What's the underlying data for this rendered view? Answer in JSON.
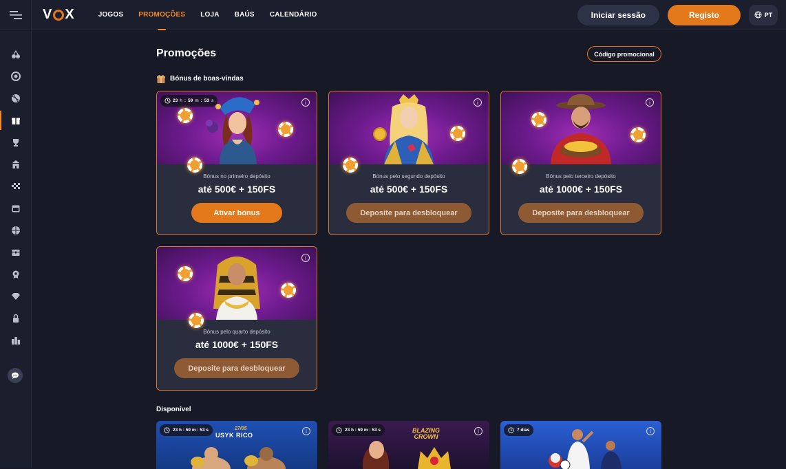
{
  "nav": {
    "logo": "VOX",
    "items": [
      {
        "label": "JOGOS",
        "active": false
      },
      {
        "label": "PROMOÇÕES",
        "active": true
      },
      {
        "label": "LOJA",
        "active": false
      },
      {
        "label": "BAÚS",
        "active": false
      },
      {
        "label": "CALENDÁRIO",
        "active": false
      }
    ],
    "login_label": "Iniciar sessão",
    "register_label": "Registo",
    "lang_label": "PT"
  },
  "sidebar": {
    "icons": [
      "cherries-icon",
      "casino-chip-icon",
      "sports-ball-icon",
      "gift-icon",
      "trophy-icon",
      "shop-icon",
      "racing-flag-icon",
      "calendar-icon",
      "basketball-icon",
      "chest-icon",
      "badge-icon",
      "diamond-icon",
      "lock-icon",
      "leaderboard-icon"
    ],
    "active_index": 3,
    "chat_icon": "chat-icon"
  },
  "page": {
    "title": "Promoções",
    "promo_code_label": "Código promocional",
    "welcome_section": "Bónus de boas-vindas",
    "available_section": "Disponível"
  },
  "welcome_cards": [
    {
      "timer": {
        "h": "23",
        "h_unit": "h",
        "m": "59",
        "m_unit": "m",
        "s": "53",
        "s_unit": "s"
      },
      "subtitle": "Bónus no primeiro depósito",
      "amount": "até 500€ + 150FS",
      "cta": "Ativar bónus",
      "locked": false
    },
    {
      "timer": null,
      "subtitle": "Bónus pelo segundo depósito",
      "amount": "até 500€ + 150FS",
      "cta": "Deposite para desbloquear",
      "locked": true
    },
    {
      "timer": null,
      "subtitle": "Bónus pelo terceiro depósito",
      "amount": "até 1000€ + 150FS",
      "cta": "Deposite para desbloquear",
      "locked": true
    },
    {
      "timer": null,
      "subtitle": "Bónus pelo quarto depósito",
      "amount": "até 1000€ + 150FS",
      "cta": "Deposite para desbloquear",
      "locked": true
    }
  ],
  "available_cards": [
    {
      "timer_text": "23 h : 59 m : 53 s",
      "art_text": "USYK RICO",
      "art_date": "27/05"
    },
    {
      "timer_text": "23 h : 59 m : 53 s",
      "art_text": "BLAZING CROWN"
    },
    {
      "timer_text": "7 dias"
    }
  ]
}
